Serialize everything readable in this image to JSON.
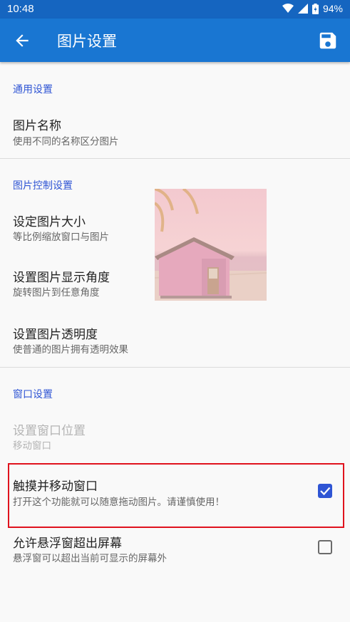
{
  "status_bar": {
    "time": "10:48",
    "battery": "94%",
    "icons": [
      "wifi-icon",
      "signal-icon",
      "battery-icon"
    ]
  },
  "app_bar": {
    "title": "图片设置",
    "back_icon": "arrow-back-icon",
    "save_icon": "save-icon"
  },
  "sections": [
    {
      "header": "通用设置",
      "items": [
        {
          "title": "图片名称",
          "subtitle": "使用不同的名称区分图片"
        }
      ]
    },
    {
      "header": "图片控制设置",
      "items": [
        {
          "title": "设定图片大小",
          "subtitle": "等比例缩放窗口与图片"
        },
        {
          "title": "设置图片显示角度",
          "subtitle": "旋转图片到任意角度"
        },
        {
          "title": "设置图片透明度",
          "subtitle": "使普通的图片拥有透明效果"
        }
      ]
    },
    {
      "header": "窗口设置",
      "items": [
        {
          "title": "设置窗口位置",
          "subtitle": "移动窗口",
          "enabled": false
        },
        {
          "title": "触摸并移动窗口",
          "subtitle": "打开这个功能就可以随意拖动图片。请谨慎使用！",
          "checked": true
        },
        {
          "title": "允许悬浮窗超出屏幕",
          "subtitle": "悬浮窗可以超出当前可显示的屏幕外",
          "checked": false
        }
      ]
    }
  ],
  "colors": {
    "app_bar": "#1976d2",
    "status_bar": "#1565c0",
    "accent": "#2f55d4",
    "highlight": "#e0121d"
  }
}
